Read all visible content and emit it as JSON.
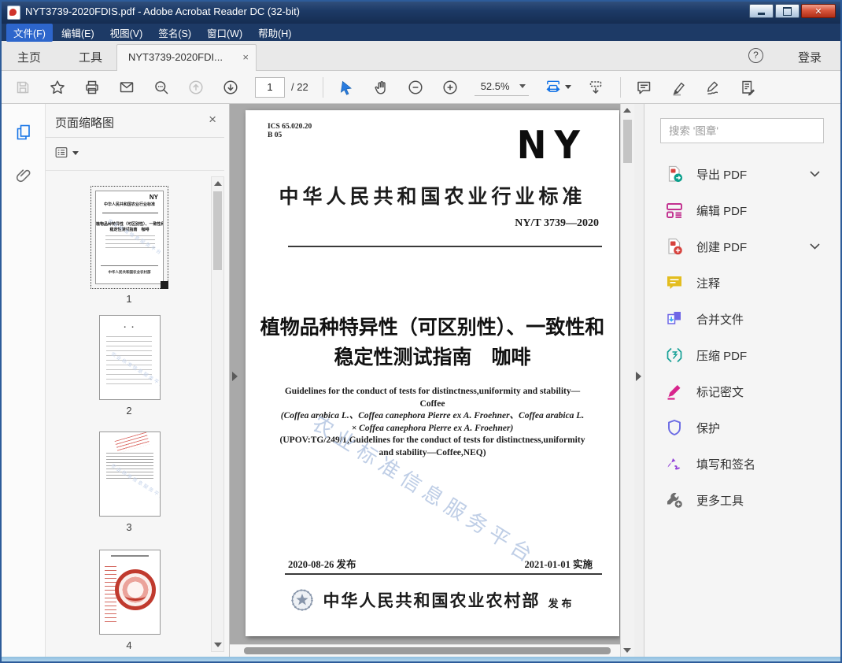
{
  "window": {
    "title": "NYT3739-2020FDIS.pdf - Adobe Acrobat Reader DC (32-bit)"
  },
  "menu": {
    "items": [
      "文件(F)",
      "编辑(E)",
      "视图(V)",
      "签名(S)",
      "窗口(W)",
      "帮助(H)"
    ]
  },
  "tabs": {
    "home": "主页",
    "tools": "工具",
    "document": "NYT3739-2020FDI...",
    "close_glyph": "×",
    "help_glyph": "?",
    "login": "登录"
  },
  "toolbar": {
    "page_current": "1",
    "page_total": "/ 22",
    "zoom_value": "52.5%"
  },
  "left_panel": {
    "title": "页面缩略图",
    "close_glyph": "×",
    "page_numbers": [
      "1",
      "2",
      "3",
      "4"
    ]
  },
  "document": {
    "ics_line1": "ICS 65.020.20",
    "ics_line2": "B 05",
    "logo": "NY",
    "standard_heading": "中华人民共和国农业行业标准",
    "standard_number": "NY/T 3739—2020",
    "title_line1": "植物品种特异性（可区别性）、一致性和",
    "title_line2": "稳定性测试指南　咖啡",
    "english_lines": [
      "Guidelines for the conduct of tests for distinctness,uniformity and stability—",
      "Coffee",
      "(Coffea arabica L.、Coffea canephora Pierre ex A. Froehner、Coffea arabica L.",
      "× Coffea canephora Pierre ex A. Froehner)",
      "(UPOV:TG/249/1,Guidelines for the conduct of tests for distinctness,uniformity",
      "and stability—Coffee,NEQ)"
    ],
    "watermark": "农业标准信息服务平台",
    "issue_date": "2020-08-26 发布",
    "implement_date": "2021-01-01 实施",
    "publisher": "中华人民共和国农业农村部",
    "publish_word": "发布"
  },
  "right_panel": {
    "search_placeholder": "搜索 '图章'",
    "tools": [
      {
        "icon": "export-pdf-icon",
        "label": "导出 PDF",
        "chevron": true
      },
      {
        "icon": "edit-pdf-icon",
        "label": "编辑 PDF",
        "chevron": false
      },
      {
        "icon": "create-pdf-icon",
        "label": "创建 PDF",
        "chevron": true
      },
      {
        "icon": "comment-icon",
        "label": "注释",
        "chevron": false
      },
      {
        "icon": "combine-files-icon",
        "label": "合并文件",
        "chevron": false
      },
      {
        "icon": "compress-pdf-icon",
        "label": "压缩 PDF",
        "chevron": false
      },
      {
        "icon": "redact-icon",
        "label": "标记密文",
        "chevron": false
      },
      {
        "icon": "protect-icon",
        "label": "保护",
        "chevron": false
      },
      {
        "icon": "fill-sign-icon",
        "label": "填写和签名",
        "chevron": false
      },
      {
        "icon": "more-tools-icon",
        "label": "更多工具",
        "chevron": false
      }
    ]
  },
  "accent_colors": {
    "titlebar_navy": "#1d3a66",
    "menu_highlight_blue": "#2d66cc",
    "acrobat_blue": "#1473e6",
    "close_button_red": "#c23a2b",
    "seal_red": "#c03a2e",
    "watermark_blue": "#b4c6e2"
  }
}
